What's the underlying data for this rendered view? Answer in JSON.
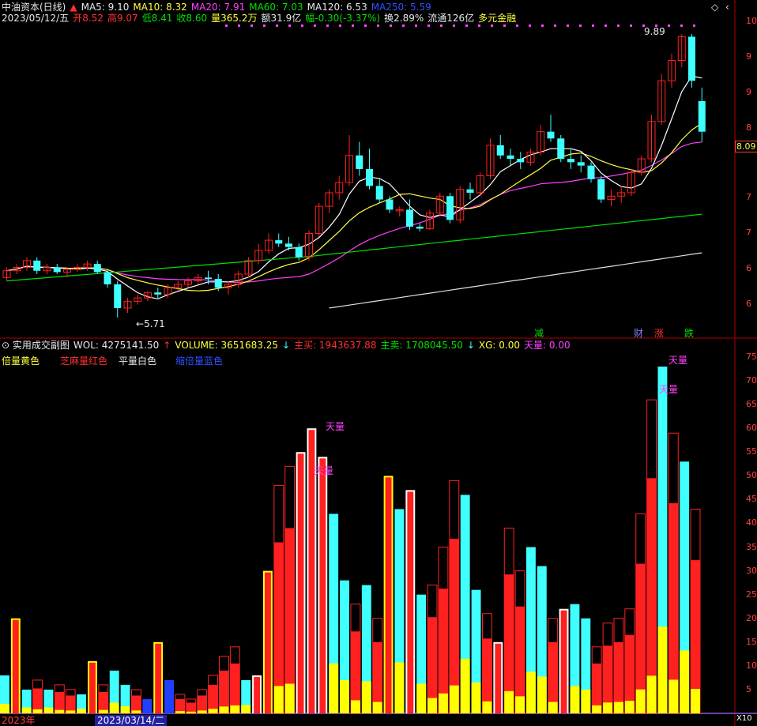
{
  "colors": {
    "up": "#ff2020",
    "down": "#40ffff",
    "ma5": "#ffffff",
    "ma10": "#ffff40",
    "ma20": "#ff40ff",
    "ma60": "#00e000",
    "ma120": "#ffffff",
    "border": "#b00000",
    "vol_double": "#ffff00",
    "vol_flat": "#ffffff",
    "vol_shrink": "#2040ff",
    "vol_sesame": "#ff2020"
  },
  "header": {
    "stock_name": "中油资本(日线)",
    "ma5": "MA5: 9.10",
    "ma10": "MA10: 8.32",
    "ma20": "MA20: 7.91",
    "ma60": "MA60: 7.03",
    "ma120": "MA120: 6.53",
    "ma250": "MA250: 5.59",
    "date": "2023/05/12/五",
    "open": "开8.52",
    "high": "高9.07",
    "low": "低8.41",
    "close": "收8.60",
    "volume": "量365.2万",
    "amount": "额31.9亿",
    "change": "幅-0.30(-3.37%)",
    "turnover": "换2.89%",
    "float_cap": "流通126亿",
    "concept": "多元金融"
  },
  "price_panel": {
    "high_marker": "9.89",
    "low_marker": "5.71",
    "current_price_tag": "8.09",
    "right_axis": [
      "10",
      "9",
      "9",
      "8",
      "8",
      "7",
      "7",
      "6",
      "6"
    ],
    "event_tags": [
      "减",
      "财",
      "涨",
      "跌"
    ]
  },
  "volume_panel": {
    "title": "实用成交副图",
    "wol": "WOL: 4275141.50",
    "volume": "VOLUME: 3651683.25",
    "zhumai": "主买: 1943637.88",
    "zhumai2": "主卖: 1708045.50",
    "xg": "XG: 0.00",
    "tianliang": "天量: 0.00",
    "legend": [
      "倍量黄色",
      "芝麻量红色",
      "平量白色",
      "缩倍量蓝色"
    ],
    "annotations": [
      "天量",
      "天量",
      "天量",
      "天量"
    ],
    "axis_labels": [
      "75",
      "70",
      "65",
      "60",
      "55",
      "50",
      "45",
      "40",
      "35",
      "30",
      "25",
      "20",
      "15",
      "10",
      "5"
    ],
    "axis_unit": "X10"
  },
  "bottom_axis": {
    "date_label": "2023/03/14/二",
    "left_fragment": "2023年"
  },
  "chart_data": {
    "type": "candlestick",
    "candles": [
      [
        6.3,
        6.45,
        6.25,
        6.4
      ],
      [
        6.4,
        6.5,
        6.35,
        6.45
      ],
      [
        6.45,
        6.6,
        6.4,
        6.55
      ],
      [
        6.55,
        6.6,
        6.35,
        6.4
      ],
      [
        6.4,
        6.5,
        6.35,
        6.45
      ],
      [
        6.45,
        6.5,
        6.35,
        6.38
      ],
      [
        6.38,
        6.45,
        6.3,
        6.42
      ],
      [
        6.42,
        6.5,
        6.38,
        6.45
      ],
      [
        6.45,
        6.55,
        6.4,
        6.5
      ],
      [
        6.5,
        6.55,
        6.35,
        6.38
      ],
      [
        6.38,
        6.42,
        6.15,
        6.2
      ],
      [
        6.2,
        6.25,
        5.71,
        5.85
      ],
      [
        5.85,
        6.0,
        5.78,
        5.95
      ],
      [
        5.95,
        6.05,
        5.9,
        6.0
      ],
      [
        6.0,
        6.1,
        5.95,
        6.08
      ],
      [
        6.08,
        6.15,
        6.0,
        6.05
      ],
      [
        6.05,
        6.2,
        6.0,
        6.15
      ],
      [
        6.15,
        6.25,
        6.1,
        6.2
      ],
      [
        6.2,
        6.3,
        6.15,
        6.25
      ],
      [
        6.25,
        6.35,
        6.2,
        6.3
      ],
      [
        6.3,
        6.4,
        6.2,
        6.28
      ],
      [
        6.28,
        6.35,
        6.1,
        6.15
      ],
      [
        6.15,
        6.25,
        6.05,
        6.2
      ],
      [
        6.2,
        6.4,
        6.15,
        6.35
      ],
      [
        6.35,
        6.6,
        6.3,
        6.55
      ],
      [
        6.55,
        6.8,
        6.5,
        6.7
      ],
      [
        6.7,
        6.95,
        6.65,
        6.85
      ],
      [
        6.85,
        6.95,
        6.75,
        6.8
      ],
      [
        6.8,
        6.9,
        6.7,
        6.75
      ],
      [
        6.75,
        6.8,
        6.55,
        6.6
      ],
      [
        6.6,
        7.0,
        6.55,
        6.95
      ],
      [
        6.95,
        7.4,
        6.9,
        7.35
      ],
      [
        7.35,
        7.6,
        7.25,
        7.55
      ],
      [
        7.55,
        7.8,
        7.45,
        7.7
      ],
      [
        7.7,
        8.4,
        7.65,
        8.1
      ],
      [
        8.1,
        8.3,
        7.8,
        7.9
      ],
      [
        7.9,
        8.2,
        7.6,
        7.65
      ],
      [
        7.65,
        7.75,
        7.4,
        7.45
      ],
      [
        7.45,
        7.5,
        7.25,
        7.3
      ],
      [
        7.3,
        7.35,
        7.2,
        7.3
      ],
      [
        7.3,
        7.45,
        7.0,
        7.05
      ],
      [
        7.05,
        7.1,
        6.98,
        7.02
      ],
      [
        7.02,
        7.3,
        7.0,
        7.25
      ],
      [
        7.25,
        7.55,
        7.2,
        7.5
      ],
      [
        7.5,
        7.55,
        7.1,
        7.15
      ],
      [
        7.15,
        7.65,
        7.1,
        7.6
      ],
      [
        7.6,
        7.7,
        7.45,
        7.55
      ],
      [
        7.55,
        7.85,
        7.5,
        7.8
      ],
      [
        7.8,
        8.35,
        7.75,
        8.25
      ],
      [
        8.25,
        8.4,
        8.05,
        8.1
      ],
      [
        8.1,
        8.2,
        7.95,
        8.05
      ],
      [
        8.05,
        8.15,
        7.9,
        8.0
      ],
      [
        8.0,
        8.2,
        7.95,
        8.15
      ],
      [
        8.15,
        8.55,
        8.1,
        8.45
      ],
      [
        8.45,
        8.7,
        8.3,
        8.35
      ],
      [
        8.35,
        8.4,
        8.0,
        8.05
      ],
      [
        8.05,
        8.2,
        7.9,
        8.0
      ],
      [
        8.0,
        8.1,
        7.85,
        7.95
      ],
      [
        7.95,
        8.0,
        7.7,
        7.75
      ],
      [
        7.75,
        7.8,
        7.4,
        7.45
      ],
      [
        7.45,
        7.6,
        7.35,
        7.5
      ],
      [
        7.5,
        7.65,
        7.4,
        7.55
      ],
      [
        7.55,
        7.9,
        7.5,
        7.85
      ],
      [
        7.85,
        8.1,
        7.8,
        8.05
      ],
      [
        8.05,
        8.7,
        8.0,
        8.6
      ],
      [
        8.6,
        9.3,
        8.55,
        9.2
      ],
      [
        9.2,
        9.6,
        9.1,
        9.5
      ],
      [
        9.5,
        9.89,
        9.4,
        9.85
      ],
      [
        9.85,
        9.89,
        9.1,
        9.2
      ],
      [
        8.9,
        9.1,
        8.3,
        8.45
      ]
    ],
    "volumes": [
      [
        8,
        "down"
      ],
      [
        20,
        "double"
      ],
      [
        5,
        "down"
      ],
      [
        7,
        "up"
      ],
      [
        5,
        "down"
      ],
      [
        6,
        "up"
      ],
      [
        5,
        "up"
      ],
      [
        4,
        "down"
      ],
      [
        11,
        "double"
      ],
      [
        6,
        "up"
      ],
      [
        9,
        "down"
      ],
      [
        6,
        "down"
      ],
      [
        5,
        "up"
      ],
      [
        3,
        "shrink"
      ],
      [
        15,
        "double"
      ],
      [
        7,
        "shrink"
      ],
      [
        4,
        "up"
      ],
      [
        3,
        "up"
      ],
      [
        5,
        "up"
      ],
      [
        8,
        "up"
      ],
      [
        12,
        "up"
      ],
      [
        14,
        "up"
      ],
      [
        7,
        "down"
      ],
      [
        8,
        "flat"
      ],
      [
        30,
        "double"
      ],
      [
        48,
        "up"
      ],
      [
        52,
        "up"
      ],
      [
        55,
        "flat"
      ],
      [
        60,
        "flat"
      ],
      [
        54,
        "flat"
      ],
      [
        42,
        "down"
      ],
      [
        28,
        "down"
      ],
      [
        23,
        "up"
      ],
      [
        27,
        "down"
      ],
      [
        20,
        "up"
      ],
      [
        50,
        "double"
      ],
      [
        43,
        "down"
      ],
      [
        47,
        "flat"
      ],
      [
        25,
        "down"
      ],
      [
        27,
        "up"
      ],
      [
        35,
        "up"
      ],
      [
        49,
        "up"
      ],
      [
        46,
        "down"
      ],
      [
        26,
        "down"
      ],
      [
        21,
        "up"
      ],
      [
        15,
        "flat"
      ],
      [
        39,
        "up"
      ],
      [
        30,
        "up"
      ],
      [
        35,
        "down"
      ],
      [
        31,
        "down"
      ],
      [
        20,
        "up"
      ],
      [
        22,
        "flat"
      ],
      [
        23,
        "down"
      ],
      [
        20,
        "down"
      ],
      [
        14,
        "up"
      ],
      [
        19,
        "up"
      ],
      [
        20,
        "up"
      ],
      [
        22,
        "up"
      ],
      [
        42,
        "up"
      ],
      [
        66,
        "up"
      ],
      [
        73,
        "down"
      ],
      [
        59,
        "up"
      ],
      [
        53,
        "down"
      ],
      [
        43,
        "up"
      ]
    ]
  }
}
